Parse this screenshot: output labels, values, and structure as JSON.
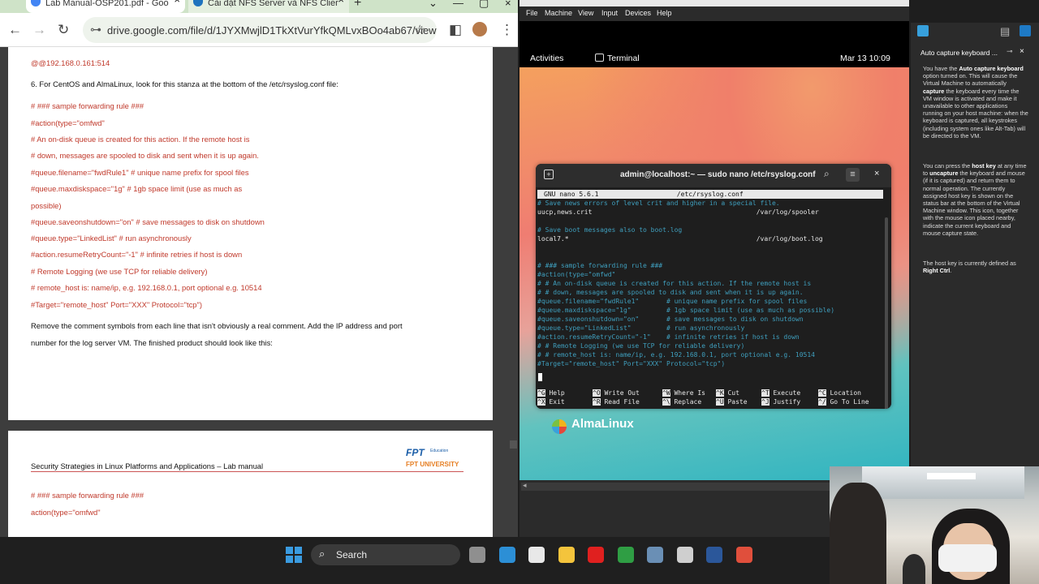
{
  "chrome": {
    "tabs": [
      {
        "title": "Lab Manual-OSP201.pdf - Goo",
        "close": "×"
      },
      {
        "title": "Cài đặt NFS Server và NFS Clier",
        "close": "×"
      }
    ],
    "new_tab": "+",
    "window_controls": [
      "⌄",
      "—",
      "▢",
      "×"
    ],
    "url": "drive.google.com/file/d/1JYXMwjlD1TkXtVurYfkQMLvxBOo4ab67/view",
    "nav_icons": {
      "back": "←",
      "forward": "→",
      "reload": "↻",
      "menu": "⋮",
      "sidepanel": "◧",
      "star": "☆",
      "tune": "⊶"
    }
  },
  "pdf": {
    "page1": [
      {
        "text": "@@192.168.0.161:514",
        "style": "red"
      },
      {
        "text": "6. For CentOS and AlmaLinux, look for this stanza at the bottom of the /etc/rsyslog.conf file:",
        "style": "blk"
      },
      {
        "text": "# ### sample forwarding rule ###",
        "style": "red"
      },
      {
        "text": "#action(type=\"omfwd\"",
        "style": "red"
      },
      {
        "text": "# An on-disk queue is created for this action. If the remote host is",
        "style": "red"
      },
      {
        "text": "# down, messages are spooled to disk and sent when it is up again.",
        "style": "red"
      },
      {
        "text": "#queue.filename=\"fwdRule1\"       # unique name prefix for spool files",
        "style": "red"
      },
      {
        "text": "#queue.maxdiskspace=\"1g\"         # 1gb space limit (use as much as",
        "style": "red"
      },
      {
        "text": "possible)",
        "style": "red"
      },
      {
        "text": "#queue.saveonshutdown=\"on\"        # save messages to disk on shutdown",
        "style": "red"
      },
      {
        "text": "#queue.type=\"LinkedList\"         # run asynchronously",
        "style": "red"
      },
      {
        "text": "#action.resumeRetryCount=\"-1\"     # infinite retries if host is down",
        "style": "red"
      },
      {
        "text": "# Remote Logging (we use TCP for reliable delivery)",
        "style": "red"
      },
      {
        "text": "# remote_host is: name/ip, e.g. 192.168.0.1, port optional e.g. 10514",
        "style": "red"
      },
      {
        "text": "#Target=\"remote_host\" Port=\"XXX\" Protocol=\"tcp\")",
        "style": "red"
      },
      {
        "text": "Remove the comment symbols from each line that isn't obviously a real comment. Add the IP address and port",
        "style": "blk"
      },
      {
        "text": "number for the log server VM. The finished product should look like this:",
        "style": "blk"
      }
    ],
    "page2": {
      "header": "Security Strategies in Linux Platforms and Applications – Lab manual",
      "logo_mark": "FPT",
      "logo_edu": "Education",
      "logo_uni": "FPT UNIVERSITY",
      "lines": [
        {
          "text": "# ### sample forwarding rule ###",
          "style": "red"
        },
        {
          "text": "action(type=\"omfwd\"",
          "style": "red"
        }
      ]
    }
  },
  "vbox": {
    "menu": [
      "File",
      "Machine",
      "View",
      "Input",
      "Devices",
      "Help"
    ],
    "gnome": {
      "activities": "Activities",
      "app": "Terminal",
      "clock": "Mar 13  10:09",
      "distro": "AlmaLinux"
    },
    "terminal": {
      "title": "admin@localhost:~ — sudo nano /etc/rsyslog.conf",
      "new_tab_icon": "+",
      "search_icon": "⌕",
      "menu_icon": "≡",
      "close_icon": "×",
      "nano_header": "GNU nano 5.6.1                    /etc/rsyslog.conf",
      "lines": [
        {
          "text": "# Save news errors of level crit and higher in a special file.",
          "kind": "cmt"
        },
        {
          "text": "uucp,news.crit                                          /var/log/spooler",
          "kind": "plain"
        },
        {
          "text": "",
          "kind": "plain"
        },
        {
          "text": "# Save boot messages also to boot.log",
          "kind": "cmt"
        },
        {
          "text": "local7.*                                                /var/log/boot.log",
          "kind": "plain"
        },
        {
          "text": "",
          "kind": "plain"
        },
        {
          "text": "",
          "kind": "plain"
        },
        {
          "text": "# ### sample forwarding rule ###",
          "kind": "cmt"
        },
        {
          "text": "#action(type=\"omfwd\"",
          "kind": "cmt"
        },
        {
          "text": "# # An on-disk queue is created for this action. If the remote host is",
          "kind": "cmt"
        },
        {
          "text": "# # down, messages are spooled to disk and sent when it is up again.",
          "kind": "cmt"
        },
        {
          "text": "#queue.filename=\"fwdRule1\"       # unique name prefix for spool files",
          "kind": "cmt"
        },
        {
          "text": "#queue.maxdiskspace=\"1g\"         # 1gb space limit (use as much as possible)",
          "kind": "cmt"
        },
        {
          "text": "#queue.saveonshutdown=\"on\"       # save messages to disk on shutdown",
          "kind": "cmt"
        },
        {
          "text": "#queue.type=\"LinkedList\"         # run asynchronously",
          "kind": "cmt"
        },
        {
          "text": "#action.resumeRetryCount=\"-1\"    # infinite retries if host is down",
          "kind": "cmt"
        },
        {
          "text": "# # Remote Logging (we use TCP for reliable delivery)",
          "kind": "cmt"
        },
        {
          "text": "# # remote_host is: name/ip, e.g. 192.168.0.1, port optional e.g. 10514",
          "kind": "cmt"
        },
        {
          "text": "#Target=\"remote_host\" Port=\"XXX\" Protocol=\"tcp\")",
          "kind": "cmt"
        }
      ],
      "shortcuts": [
        [
          {
            "key": "^G",
            "label": "Help"
          },
          {
            "key": "^O",
            "label": "Write Out"
          },
          {
            "key": "^W",
            "label": "Where Is"
          },
          {
            "key": "^K",
            "label": "Cut"
          },
          {
            "key": "^T",
            "label": "Execute"
          },
          {
            "key": "^C",
            "label": "Location"
          }
        ],
        [
          {
            "key": "^X",
            "label": "Exit"
          },
          {
            "key": "^R",
            "label": "Read File"
          },
          {
            "key": "^\\",
            "label": "Replace"
          },
          {
            "key": "^U",
            "label": "Paste"
          },
          {
            "key": "^J",
            "label": "Justify"
          },
          {
            "key": "^/",
            "label": "Go To Line"
          }
        ]
      ]
    }
  },
  "notification": {
    "title": "Auto capture keyboard ...",
    "min": "⊸",
    "close": "×",
    "p1_html": "You have the <b>Auto capture keyboard</b> option turned on. This will cause the Virtual Machine to automatically <b>capture</b> the keyboard every time the VM window is activated and make it unavailable to other applications running on your host machine: when the keyboard is captured, all keystrokes (including system ones like Alt-Tab) will be directed to the VM.",
    "p2_html": "You can press the <b>host key</b> at any time to <b>uncapture</b> the keyboard and mouse (if it is captured) and return them to normal operation. The currently assigned host key is shown on the status bar at the bottom of the Virtual Machine window. This icon, together with the mouse icon placed nearby, indicate the current keyboard and mouse capture state.",
    "p3_html": "The host key is currently defined as <b>Right Ctrl</b>."
  },
  "taskbar": {
    "search_label": "Search",
    "search_icon": "⌕",
    "apps": [
      {
        "name": "file-explorer-icon",
        "color": "#8f8f8f"
      },
      {
        "name": "edge-icon",
        "color": "#2c8fd6"
      },
      {
        "name": "store-icon",
        "color": "#e8e8e8"
      },
      {
        "name": "folder-icon",
        "color": "#f4c43c"
      },
      {
        "name": "opera-icon",
        "color": "#e0201f"
      },
      {
        "name": "chrome-icon",
        "color": "#2f9e44"
      },
      {
        "name": "virtualbox-icon",
        "color": "#6a8fb5"
      },
      {
        "name": "obs-icon",
        "color": "#cfcfcf"
      },
      {
        "name": "word-icon",
        "color": "#2b579a"
      },
      {
        "name": "snipping-icon",
        "color": "#e04f3c"
      }
    ]
  }
}
